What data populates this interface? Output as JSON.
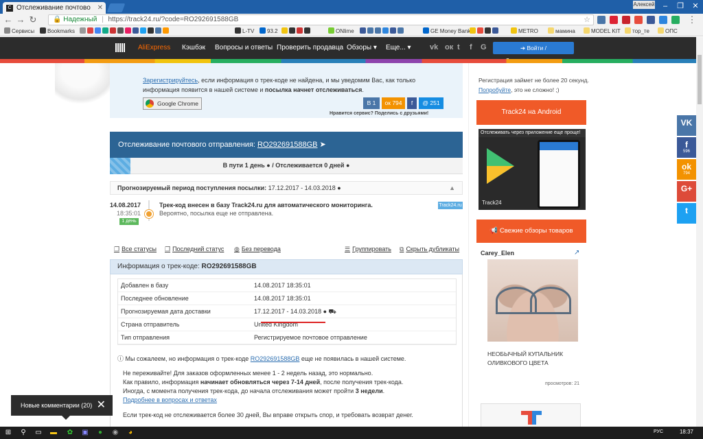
{
  "browser": {
    "tab_title": "Отслеживание почтово",
    "tab_favicon": "C",
    "user_label": "Алексей",
    "secure_label": "Надежный",
    "url": "https://track24.ru/?code=RO292691588GB",
    "bookmarks": [
      "Сервисы",
      "Bookmarks",
      "L-TV",
      "93.2",
      "ONlime",
      "GE Money Bank",
      "METRO",
      "мамина",
      "MODEL KIT",
      "тор_те",
      "ОПС"
    ]
  },
  "site_nav": {
    "brand": "AliExpress",
    "items": [
      "Кэшбэк",
      "Вопросы и ответы",
      "Проверить продавца",
      "Обзоры",
      "Еще..."
    ],
    "social": [
      "vk-icon",
      "ok-icon",
      "twitter-icon",
      "facebook-icon",
      "google-icon"
    ],
    "login_label": "Войти / Зарегистрироваться"
  },
  "info_box": {
    "register_link": "Зарегистрируйтесь",
    "text_mid": ", если информация о трек-коде не найдена, и мы уведомим Вас, как только информация появится в нашей системе и ",
    "text_bold": "посылка начнет отслеживаться",
    "text_end": ".",
    "chrome_button": "Google Chrome",
    "share_counts": {
      "vk": "1",
      "ok": "794",
      "fb": "",
      "mail": "251"
    },
    "share_tagline": "Нравится сервис? Поделись с друзьями!"
  },
  "tracking": {
    "header_prefix": "Отслеживание почтового отправления: ",
    "code": "RO292691588GB",
    "progress_text": "В пути 1 день ● / Отслеживается 0 дней ●",
    "period_label": "Прогнозируемый период поступления посылки:",
    "period_value": "17.12.2017 - 14.03.2018"
  },
  "event": {
    "date": "14.08.2017",
    "time": "18:35:01",
    "days_badge": "1 день",
    "title": "Трек-код внесен в базу Track24.ru для автоматического мониторинга.",
    "subtitle": "Вероятно, посылка еще не отправлена.",
    "source_tag": "Track24.ru"
  },
  "actions": {
    "all_statuses": "Все статусы",
    "last_status": "Последний статус",
    "no_translation": "Без перевода",
    "group": "Группировать",
    "hide_duplicates": "Скрыть дубликаты"
  },
  "info_section": {
    "title_prefix": "Информация о трек-коде: ",
    "code": "RO292691588GB",
    "rows": [
      {
        "key": "Добавлен в базу",
        "value": "14.08.2017 18:35:01"
      },
      {
        "key": "Последнее обновление",
        "value": "14.08.2017 18:35:01"
      },
      {
        "key": "Прогнозируемая дата доставки",
        "value": "17.12.2017 - 14.03.2018 ● ⛟"
      },
      {
        "key": "Страна отправитель",
        "value": "United Kingdom"
      },
      {
        "key": "Тип отправления",
        "value": "Регистрируемое почтовое отправление"
      }
    ],
    "sorry_prefix": "Мы сожалеем, но информация о трек-коде ",
    "sorry_code": "RO292691588GB",
    "sorry_suffix": " еще не появилась в нашей системе.",
    "note_line1": "Не переживайте! Для заказов оформленных менее 1 - 2 недель назад, это нормально.",
    "note_line2_a": "Как правило, информация ",
    "note_line2_b": "начинает обновляться через 7-14 дней",
    "note_line2_c": ", после получения трек-кода.",
    "note_line3_a": "Иногда, с момента получения трек-кода, до начала отслеживания может пройти ",
    "note_line3_b": "3 недели",
    "note_line3_c": ".",
    "note_link": "Подробнее в вопросах и ответах",
    "dispute_text": "Если трек-код не отслеживается более 30 дней, Вы вправе открыть спор, и требовать возврат денег."
  },
  "sidebar": {
    "reg_line1": "Регистрация займет не более 20 секунд.",
    "reg_link": "Попробуйте",
    "reg_line2_end": ", это не сложно! ;)",
    "android_title": "Track24 на Android",
    "android_banner_text": "Отслеживать через  приложение еще проще!",
    "android_watermark": "Track24",
    "reviews_title": "Свежие обзоры товаров",
    "review_author": "Carey_Elen",
    "review_desc_line1": "НЕОБЫЧНЫЙ КУПАЛЬНИК",
    "review_desc_line2": "ОЛИВКОВОГО ЦВЕТА",
    "review_views_label": "просмотров:",
    "review_views": "21"
  },
  "share_sidebar": [
    {
      "icon": "vk-icon",
      "label": "VK",
      "count": "",
      "color": "#4a76a8"
    },
    {
      "icon": "facebook-icon",
      "label": "f",
      "count": "596",
      "color": "#3b5998"
    },
    {
      "icon": "ok-icon",
      "label": "ok",
      "count": "794",
      "color": "#f39200"
    },
    {
      "icon": "google-plus-icon",
      "label": "G+",
      "count": "",
      "color": "#dd4b39"
    },
    {
      "icon": "twitter-icon",
      "label": "t",
      "count": "",
      "color": "#1da1f2"
    }
  ],
  "toast": {
    "text": "Новые комментарии (20)"
  },
  "taskbar": {
    "lang": "РУС",
    "time": "18:37"
  }
}
